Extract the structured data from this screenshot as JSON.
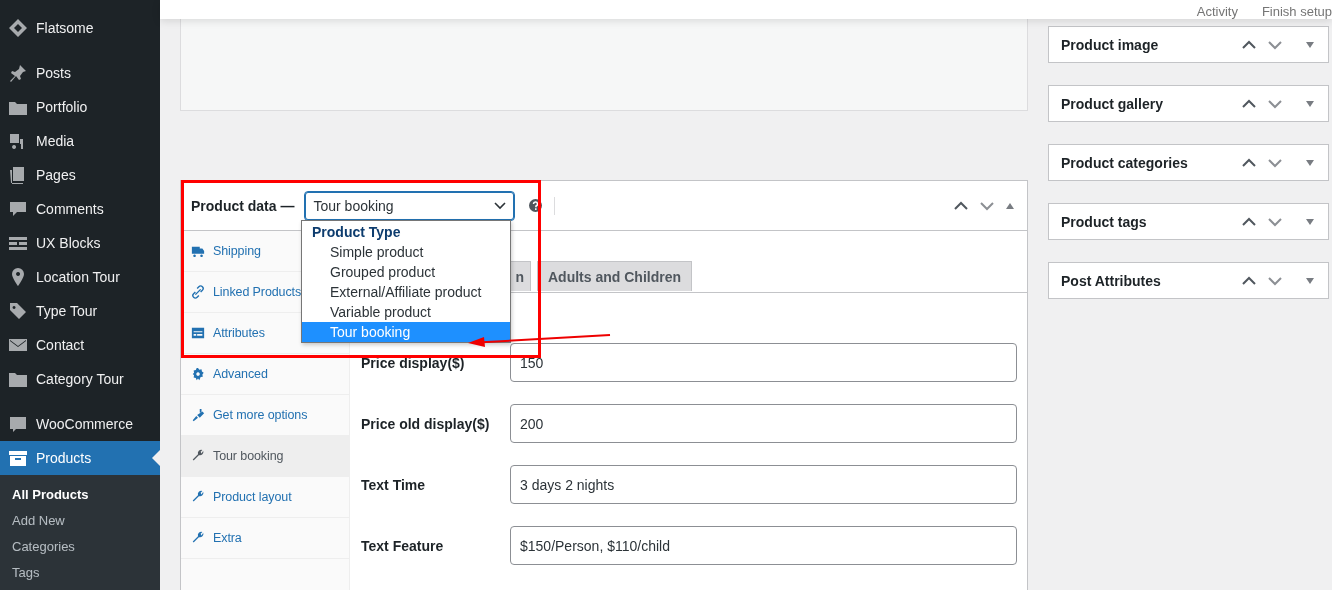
{
  "sidebar": {
    "groups": [
      {
        "items": [
          {
            "label": "Flatsome",
            "selected": false
          }
        ]
      },
      {
        "items": [
          {
            "label": "Posts",
            "selected": false
          },
          {
            "label": "Portfolio",
            "selected": false
          },
          {
            "label": "Media",
            "selected": false
          },
          {
            "label": "Pages",
            "selected": false
          },
          {
            "label": "Comments",
            "selected": false
          },
          {
            "label": "UX Blocks",
            "selected": false
          },
          {
            "label": "Location Tour",
            "selected": false
          },
          {
            "label": "Type Tour",
            "selected": false
          },
          {
            "label": "Contact",
            "selected": false
          },
          {
            "label": "Category Tour",
            "selected": false
          }
        ]
      },
      {
        "items": [
          {
            "label": "WooCommerce",
            "selected": false
          },
          {
            "label": "Products",
            "selected": true
          }
        ]
      }
    ],
    "submenu": [
      {
        "label": "All Products",
        "selected": true
      },
      {
        "label": "Add New",
        "selected": false
      },
      {
        "label": "Categories",
        "selected": false
      },
      {
        "label": "Tags",
        "selected": false
      }
    ]
  },
  "header": {
    "links": [
      "Activity",
      "Finish setup"
    ]
  },
  "product_data": {
    "title": "Product data —",
    "product_type": "Tour booking",
    "dropdown": {
      "group": "Product Type",
      "options": [
        {
          "label": "Simple product",
          "selected": false
        },
        {
          "label": "Grouped product",
          "selected": false
        },
        {
          "label": "External/Affiliate product",
          "selected": false
        },
        {
          "label": "Variable product",
          "selected": false
        },
        {
          "label": "Tour booking",
          "selected": true
        }
      ]
    },
    "tabs": [
      {
        "label": "Shipping",
        "selected": false
      },
      {
        "label": "Linked Products",
        "selected": false
      },
      {
        "label": "Attributes",
        "selected": false
      },
      {
        "label": "Advanced",
        "selected": false
      },
      {
        "label": "Get more options",
        "selected": false
      },
      {
        "label": "Tour booking",
        "selected": true
      },
      {
        "label": "Product layout",
        "selected": false
      },
      {
        "label": "Extra",
        "selected": false
      }
    ],
    "content_tabs": [
      {
        "label": "n",
        "selected": false
      },
      {
        "label": "Adults and Children",
        "selected": false
      }
    ],
    "fields": [
      {
        "label": "Price display($)",
        "value": "150"
      },
      {
        "label": "Price old display($)",
        "value": "200"
      },
      {
        "label": "Text Time",
        "value": "3 days 2 nights"
      },
      {
        "label": "Text Feature",
        "value": "$150/Person, $110/child"
      }
    ]
  },
  "side_boxes": [
    {
      "title": "Product image"
    },
    {
      "title": "Product gallery"
    },
    {
      "title": "Product categories"
    },
    {
      "title": "Product tags"
    },
    {
      "title": "Post Attributes"
    }
  ]
}
